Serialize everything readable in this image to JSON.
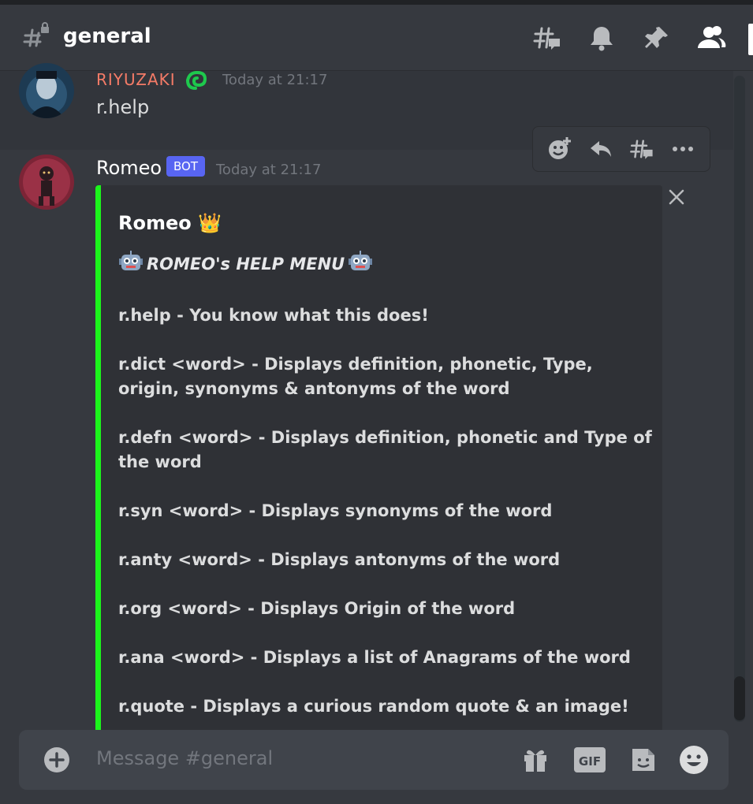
{
  "channel": {
    "name": "general",
    "input_placeholder": "Message #general"
  },
  "header_icons": [
    "threads-icon",
    "bell-icon",
    "pin-icon",
    "members-icon"
  ],
  "messages": [
    {
      "author": "RIYUZAKI",
      "author_color": "#f47b67",
      "timestamp": "Today at 21:17",
      "content": "r.help"
    },
    {
      "author": "Romeo",
      "bot_badge": "BOT",
      "timestamp": "Today at 21:17"
    }
  ],
  "embed": {
    "accent": "#1bf51b",
    "title": "Romeo 👑",
    "heading": "ROMEO's HELP MENU",
    "commands": [
      "r.help - You know what this does!",
      "r.dict <word> - Displays definition, phonetic, Type, origin, synonyms & antonyms of the word",
      "r.defn <word> - Displays definition, phonetic and Type of the word",
      "r.syn <word> - Displays synonyms of the word",
      "r.anty <word> - Displays antonyms of the word",
      "r.org <word> - Displays Origin of the word",
      "r.ana <word> - Displays a list of Anagrams of the word",
      "r.quote - Displays a curious random quote & an image!"
    ]
  },
  "composer_icons": {
    "gif_label": "GIF"
  }
}
